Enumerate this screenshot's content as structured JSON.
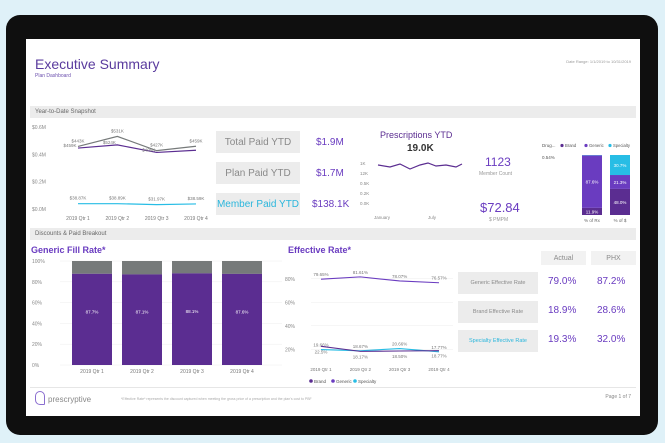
{
  "header": {
    "title": "Executive Summary",
    "subtitle": "Plan Dashboard",
    "date_range": "Date Range: 1/1/2019 to 10/31/2019"
  },
  "sections": {
    "ytd": "Year-to-Date Snapshot",
    "discounts": "Discounts & Paid Breakout"
  },
  "kpis": {
    "total_paid_label": "Total Paid YTD",
    "total_paid_value": "$1.9M",
    "plan_paid_label": "Plan Paid YTD",
    "plan_paid_value": "$1.7M",
    "member_paid_label": "Member Paid YTD",
    "member_paid_value": "$138.1K",
    "member_count_value": "1123",
    "member_count_label": "Member Count",
    "pmpm_value": "$72.84",
    "pmpm_label": "$ PMPM"
  },
  "prescriptions": {
    "title": "Prescriptions YTD",
    "value": "19.0K",
    "y_ticks": [
      "1K",
      "12K",
      "0.5K",
      "0.2K",
      "0.0K"
    ],
    "x_labels": [
      "January",
      "July"
    ]
  },
  "effective_table": {
    "col_actual": "Actual",
    "col_phx": "PHX",
    "rows": [
      {
        "label": "Generic Effective Rate",
        "actual": "79.0%",
        "phx": "87.2%"
      },
      {
        "label": "Brand Effective Rate",
        "actual": "18.9%",
        "phx": "28.6%"
      },
      {
        "label": "Specialty Effective Rate",
        "actual": "19.3%",
        "phx": "32.0%"
      }
    ]
  },
  "footer": {
    "logo": "prescryptive",
    "disclaimer": "*Effective Rate* represents the discount captured when meeting the gross price of a prescription and the plan's cost to PBF",
    "page": "Page 1 of 7"
  },
  "colors": {
    "purple": "#6a3cc0",
    "dark_purple": "#5b2d91",
    "cyan": "#27bde5",
    "gray": "#767a7a"
  },
  "chart_data": [
    {
      "type": "line",
      "categories": [
        "2019 Qtr 1",
        "2019 Qtr 2",
        "2019 Qtr 3",
        "2019 Qtr 4"
      ],
      "y_ticks": [
        "$0.6M",
        "$0.4M",
        "$0.2M",
        "$0.0M"
      ],
      "ylim": [
        0,
        0.6
      ],
      "series": [
        {
          "name": "",
          "values": [
            0.458,
            0.531,
            0.427,
            0.459
          ],
          "labels": [
            "$443K",
            "$531K",
            "$427K",
            "$459K"
          ]
        },
        {
          "name": "",
          "values": [
            0.446,
            0.469,
            0.414,
            0.43
          ],
          "labels": [
            "$459K",
            "$524K",
            "$406K",
            ""
          ]
        },
        {
          "name": "",
          "values": [
            0.039,
            0.039,
            0.032,
            0.037
          ],
          "labels": [
            "$38.87K",
            "$38.89K",
            "$31.97K",
            "$38.59K"
          ]
        }
      ]
    },
    {
      "type": "bar",
      "title": "Drug...",
      "legend": [
        "Brand",
        "Generic",
        "Specialty"
      ],
      "categories": [
        "% of Rx",
        "% of $"
      ],
      "top_label": "0.54%",
      "series": [
        {
          "name": "Brand",
          "values": [
            11.9,
            40.0
          ],
          "labels": [
            "11.9%",
            "48.0%"
          ]
        },
        {
          "name": "Generic",
          "values": [
            87.6,
            21.3
          ],
          "labels": [
            "87.6%",
            "21.3%"
          ]
        },
        {
          "name": "Specialty",
          "values": [
            0.5,
            30.7
          ],
          "labels": [
            "",
            "30.7%"
          ]
        }
      ]
    },
    {
      "type": "bar",
      "title": "Generic Fill Rate*",
      "categories": [
        "2019 Qtr 1",
        "2019 Qtr 2",
        "2019 Qtr 3",
        "2019 Qtr 4"
      ],
      "y_ticks": [
        "100%",
        "80%",
        "60%",
        "40%",
        "20%",
        "0%"
      ],
      "ylim": [
        0,
        100
      ],
      "values": [
        87.7,
        87.1,
        88.1,
        87.6
      ],
      "labels": [
        "87.7%",
        "87.1%",
        "88.1%",
        "87.6%"
      ]
    },
    {
      "type": "line",
      "title": "Effective Rate*",
      "categories": [
        "2019 Qtr 1",
        "2019 Qtr 2",
        "2019 Qtr 3",
        "2019 Qtr 4"
      ],
      "y_ticks": [
        "80%",
        "60%",
        "40%",
        "20%"
      ],
      "ylim": [
        10,
        90
      ],
      "legend": [
        "Brand",
        "Generic",
        "Specialty"
      ],
      "series": [
        {
          "name": "Generic",
          "values": [
            79.6,
            81.6,
            78.1,
            76.6
          ],
          "labels": [
            "79.65%",
            "81.61%",
            "78.07%",
            "76.57%"
          ]
        },
        {
          "name": "Specialty",
          "values": [
            19.7,
            18.7,
            20.6,
            17.8
          ],
          "labels": [
            "19.66%",
            "18.67%",
            "20.66%",
            "17.77%"
          ]
        },
        {
          "name": "Brand",
          "values": [
            22.5,
            18.2,
            18.5,
            18.8
          ],
          "labels": [
            "22.5%",
            "18.17%",
            "18.50%",
            "18.77%"
          ]
        }
      ]
    }
  ]
}
